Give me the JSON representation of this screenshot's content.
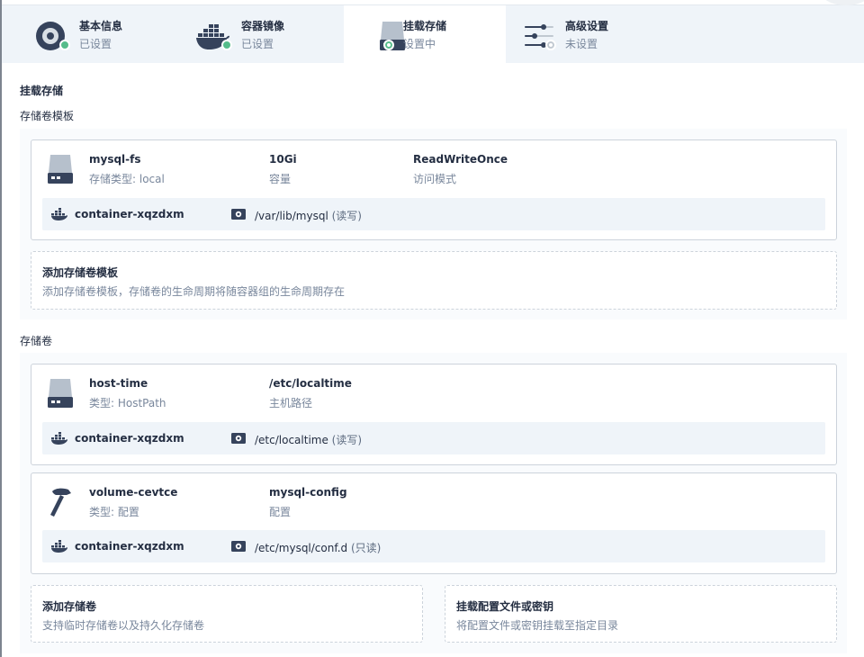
{
  "steps": [
    {
      "title": "基本信息",
      "status": "已设置",
      "icon": "disc-icon",
      "state": "done"
    },
    {
      "title": "容器镜像",
      "status": "已设置",
      "icon": "docker-icon",
      "state": "done"
    },
    {
      "title": "挂载存储",
      "status": "设置中",
      "icon": "storage-disk-icon",
      "state": "in-progress"
    },
    {
      "title": "高级设置",
      "status": "未设置",
      "icon": "sliders-icon",
      "state": "not-set"
    }
  ],
  "page": {
    "heading": "挂载存储",
    "templates_heading": "存储卷模板",
    "volumes_heading": "存储卷"
  },
  "templates": [
    {
      "name": "mysql-fs",
      "type_text": "存储类型: local",
      "capacity": "10Gi",
      "capacity_label": "容量",
      "access_mode": "ReadWriteOnce",
      "access_mode_label": "访问模式",
      "mount": {
        "container": "container-xqzdxm",
        "path": "/var/lib/mysql",
        "mode": "(读写)"
      }
    }
  ],
  "add_template": {
    "title": "添加存储卷模板",
    "desc": "添加存储卷模板，存储卷的生命周期将随容器组的生命周期存在"
  },
  "volumes": [
    {
      "name": "host-time",
      "type_text": "类型: HostPath",
      "value": "/etc/localtime",
      "value_label": "主机路径",
      "icon": "storage-disk-icon",
      "mount": {
        "container": "container-xqzdxm",
        "path": "/etc/localtime",
        "mode": "(读写)"
      }
    },
    {
      "name": "volume-cevtce",
      "type_text": "类型: 配置",
      "value": "mysql-config",
      "value_label": "配置",
      "icon": "hammer-icon",
      "mount": {
        "container": "container-xqzdxm",
        "path": "/etc/mysql/conf.d",
        "mode": "(只读)"
      }
    }
  ],
  "add_volume": {
    "title": "添加存储卷",
    "desc": "支持临时存储卷以及持久化存储卷"
  },
  "mount_config": {
    "title": "挂载配置文件或密钥",
    "desc": "将配置文件或密钥挂载至指定目录"
  },
  "colors": {
    "accent_green": "#55bc8a",
    "text_primary": "#242e42",
    "text_secondary": "#79879c",
    "tab_bg": "#eff4f9"
  }
}
